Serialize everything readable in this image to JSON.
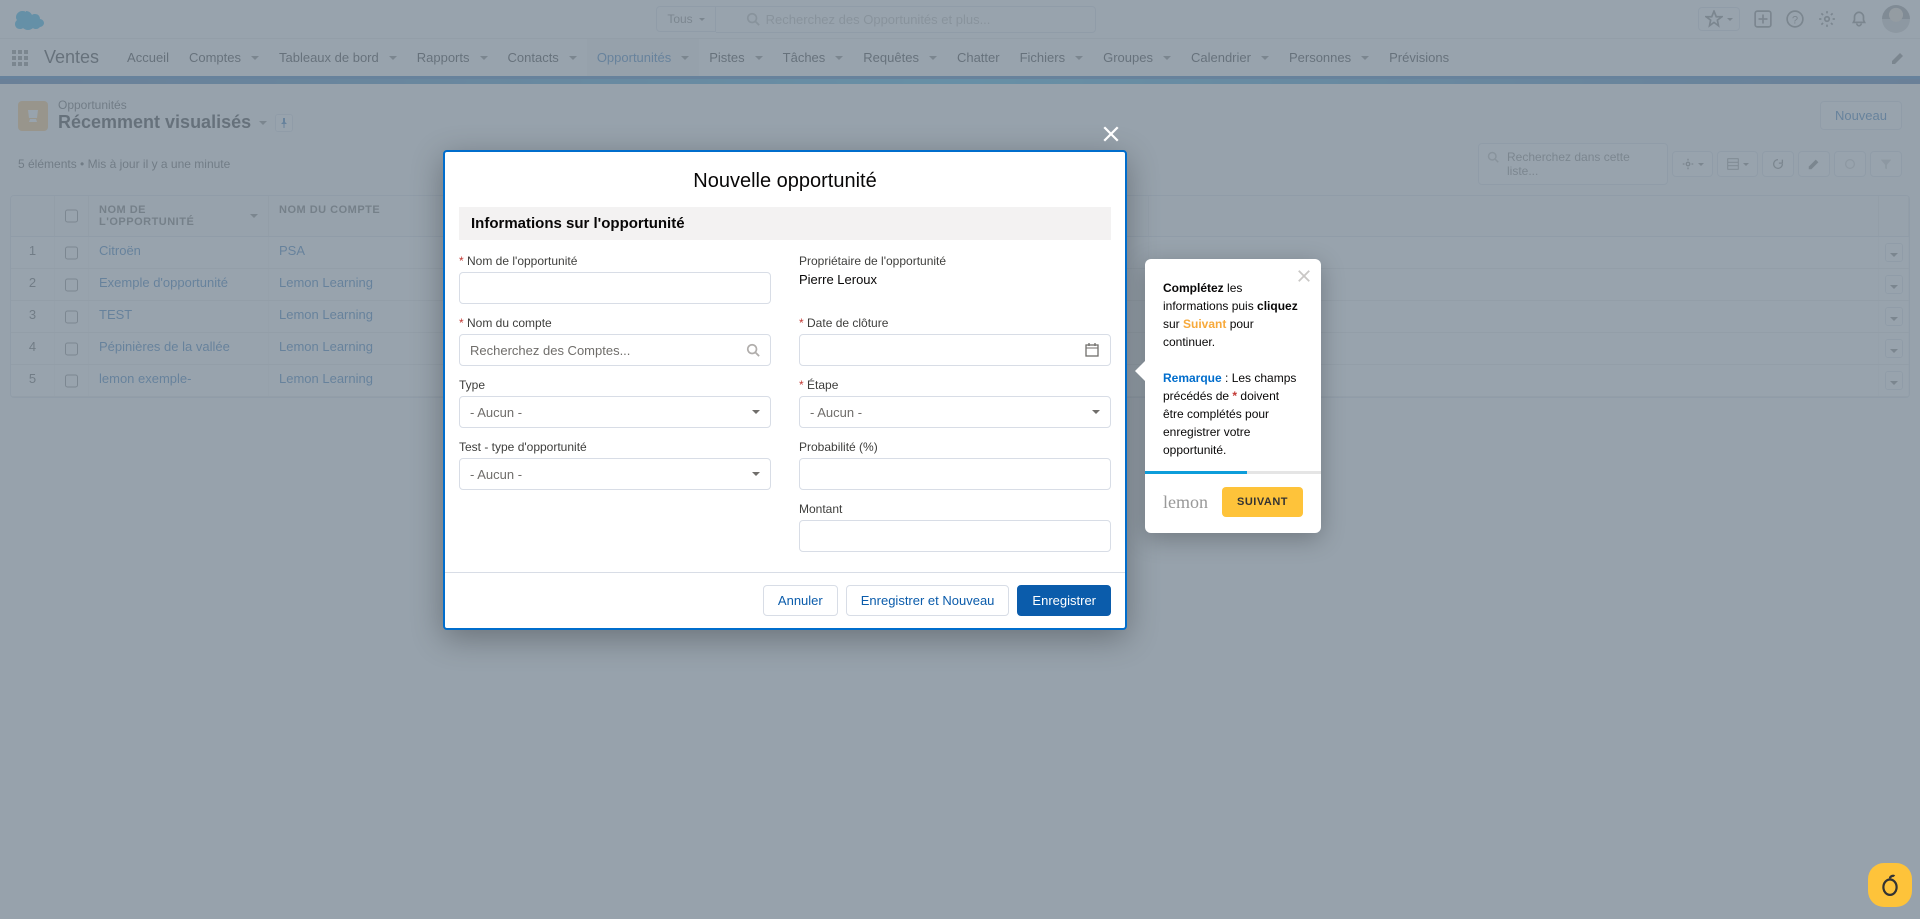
{
  "header": {
    "search_scope": "Tous",
    "search_placeholder": "Recherchez des Opportunités et plus..."
  },
  "nav": {
    "app_name": "Ventes",
    "tabs": [
      "Accueil",
      "Comptes",
      "Tableaux de bord",
      "Rapports",
      "Contacts",
      "Opportunités",
      "Pistes",
      "Tâches",
      "Requêtes",
      "Chatter",
      "Fichiers",
      "Groupes",
      "Calendrier",
      "Personnes",
      "Prévisions"
    ],
    "active_index": 5
  },
  "page_header": {
    "label": "Opportunités",
    "title": "Récemment visualisés",
    "new_btn": "Nouveau"
  },
  "toolbar": {
    "info": "5 éléments • Mis à jour il y a une minute",
    "list_search_placeholder": "Recherchez dans cette liste..."
  },
  "table": {
    "col_name": "NOM DE L'OPPORTUNITÉ",
    "col_account": "NOM DU COMPTE",
    "rows": [
      {
        "n": "1",
        "name": "Citroën",
        "account": "PSA"
      },
      {
        "n": "2",
        "name": "Exemple d'opportunité",
        "account": "Lemon Learning"
      },
      {
        "n": "3",
        "name": "TEST",
        "account": "Lemon Learning"
      },
      {
        "n": "4",
        "name": "Pépinières de la vallée",
        "account": "Lemon Learning"
      },
      {
        "n": "5",
        "name": "lemon exemple-",
        "account": "Lemon Learning"
      }
    ]
  },
  "modal": {
    "title": "Nouvelle opportunité",
    "section": "Informations sur l'opportunité",
    "labels": {
      "nom": "Nom de l'opportunité",
      "proprietaire": "Propriétaire de l'opportunité",
      "proprietaire_val": "Pierre Leroux",
      "compte": "Nom du compte",
      "compte_ph": "Recherchez des Comptes...",
      "date": "Date de clôture",
      "type": "Type",
      "etape": "Étape",
      "test": "Test - type d'opportunité",
      "proba": "Probabilité (%)",
      "montant": "Montant",
      "aucun": "- Aucun -"
    },
    "footer": {
      "cancel": "Annuler",
      "save_new": "Enregistrer et Nouveau",
      "save": "Enregistrer"
    }
  },
  "popover": {
    "t1a": "Complétez",
    "t1b": " les informations puis ",
    "t1c": "cliquez",
    "t1d": " sur ",
    "t1e": "Suivant",
    "t1f": " pour continuer.",
    "t2a": "Remarque",
    "t2b": " : Les champs précédés de ",
    "t2c": "*",
    "t2d": " doivent être complétés pour enregistrer votre opportunité.",
    "btn": "SUIVANT",
    "logo": "lemon"
  }
}
